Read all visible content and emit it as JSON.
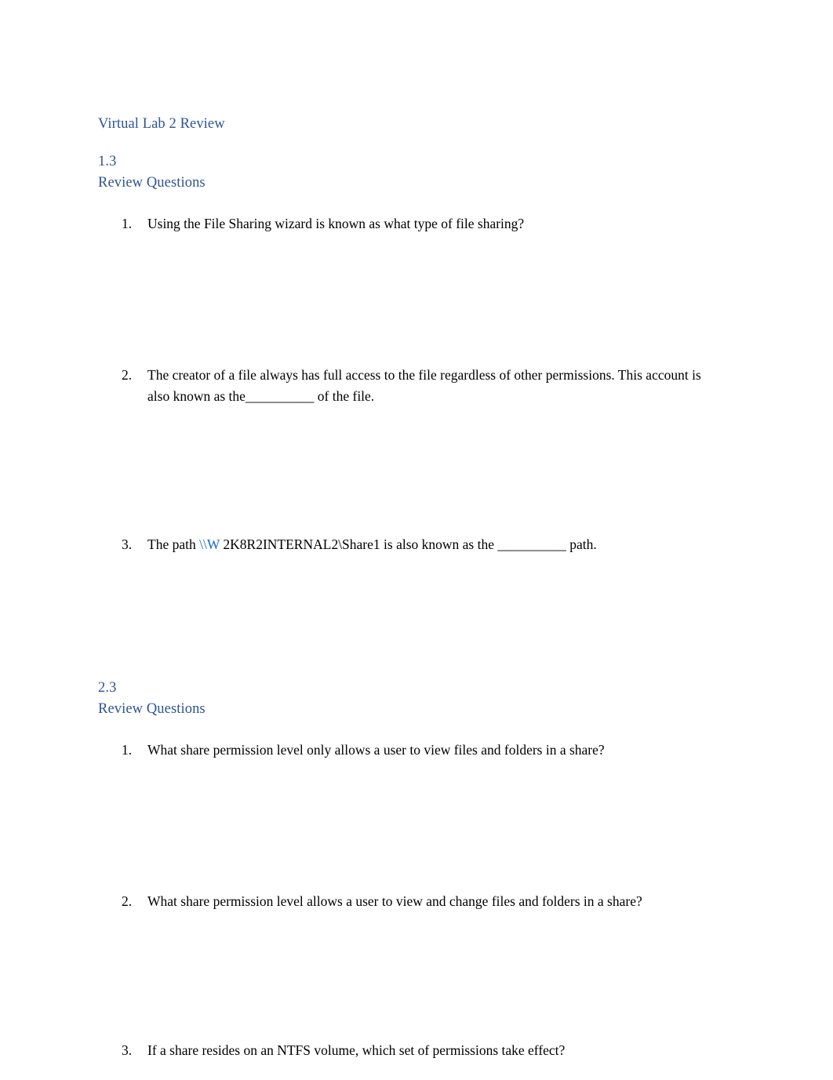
{
  "document": {
    "title": "Virtual Lab 2 Review",
    "heading_color": "#2E5395",
    "body_color": "#000000",
    "link_color": "#1267CF",
    "background": "#ffffff"
  },
  "sections": [
    {
      "number": "1.3",
      "label": "Review Questions",
      "questions": [
        {
          "num": "1.",
          "text": "Using the File Sharing wizard is known as what type of file sharing?"
        },
        {
          "num": "2.",
          "text": "The creator of a file always has full access to the file regardless of other permissions. This account is also known as the__________ of the file."
        },
        {
          "num": "3.",
          "text_before_link": "The path ",
          "link_text": "\\\\W",
          "text_after_link": " 2K8R2INTERNAL2\\Share1 is also known as the __________ path."
        }
      ]
    },
    {
      "number": "2.3",
      "label": "Review Questions",
      "questions": [
        {
          "num": "1.",
          "text": "What share permission level only allows a user to view files and folders in a share?"
        },
        {
          "num": "2.",
          "text": "What share permission level allows a user to view and change files and folders in a share?"
        },
        {
          "num": "3.",
          "text": "If a share resides on an NTFS volume, which set of permissions take effect?"
        }
      ]
    }
  ]
}
